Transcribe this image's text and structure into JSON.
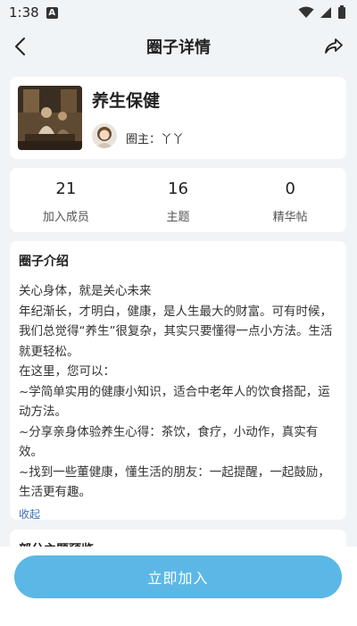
{
  "status_bar": {
    "time": "1:38",
    "a_badge": "A"
  },
  "nav": {
    "title": "圈子详情"
  },
  "circle": {
    "name": "养生保健",
    "owner_label": "圈主：",
    "owner_name": "丫丫"
  },
  "stats": [
    {
      "value": "21",
      "label": "加入成员"
    },
    {
      "value": "16",
      "label": "主题"
    },
    {
      "value": "0",
      "label": "精华帖"
    }
  ],
  "intro": {
    "title": "圈子介绍",
    "lines": [
      "关心身体，就是关心未来",
      "年纪渐长，才明白，健康，是人生最大的财富。可有时候，我们总觉得“养生”很复杂，其实只要懂得一点小方法。生活就更轻松。",
      "在这里，您可以：",
      "~学简单实用的健康小知识，适合中老年人的饮食搭配，运动方法。",
      "~分享亲身体验养生心得：茶饮，食疗，小动作，真实有效。",
      "~找到一些董健康，懂生活的朋友：一起提醒，一起鼓励，生活更有趣。"
    ],
    "collapse_label": "收起"
  },
  "preview": {
    "title": "部分主题预览"
  },
  "actions": {
    "join_label": "立即加入"
  }
}
